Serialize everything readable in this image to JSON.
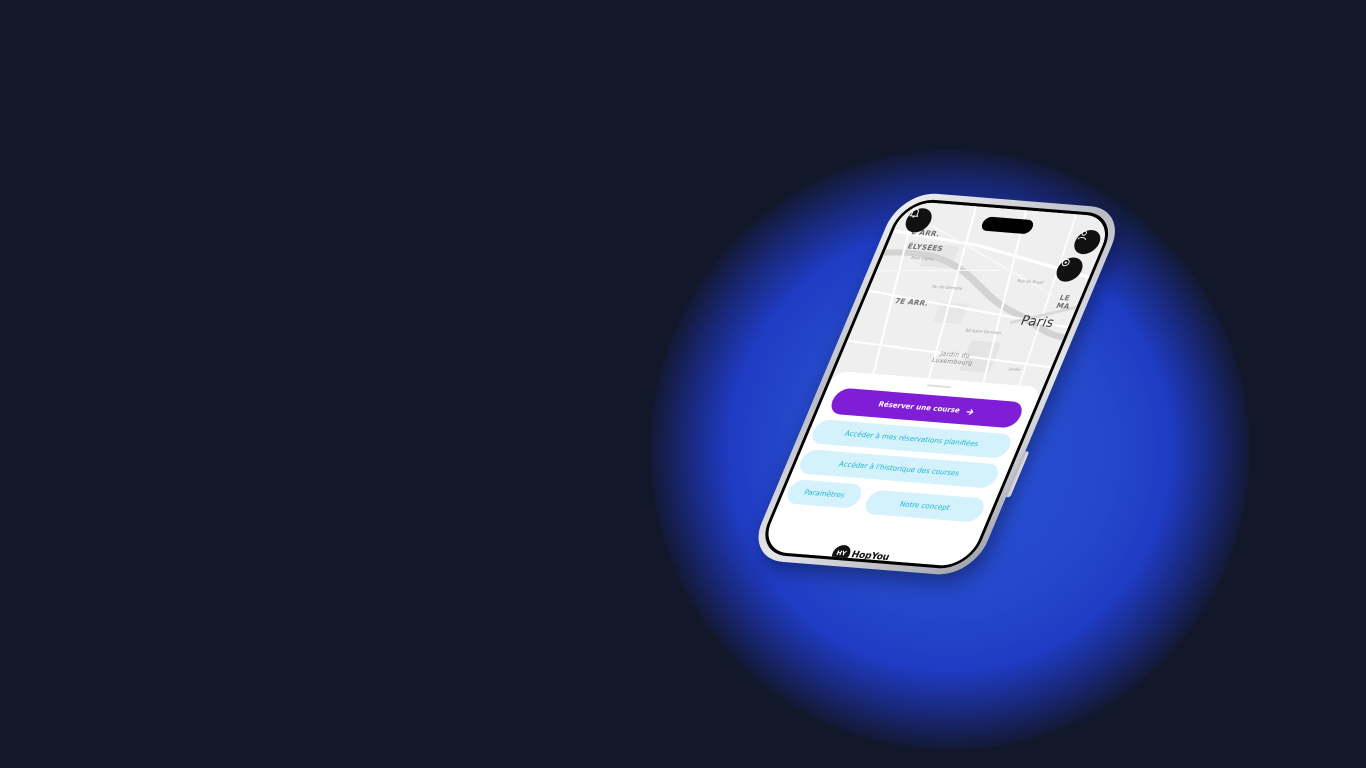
{
  "map": {
    "labels": {
      "arr8": "E ARR.",
      "elysees": "ÉLYSÉES",
      "arr7": "7E ARR.",
      "paris": "Paris",
      "luxembourg": "Jardin du Luxembourg",
      "lema": "LE MA",
      "street_1": "Pont d'Iéna",
      "street_2": "Av. de Grenelle",
      "street_3": "Rue de Rivoli",
      "street_4": "Bd Saint-Germain",
      "street_5": "Jardin"
    }
  },
  "sheet": {
    "primary_button": "Réserver une course",
    "reservations_button": "Accéder à mes réservations planifiées",
    "history_button": "Accéder à l'historique des courses",
    "settings_button": "Paramètres",
    "concept_button": "Notre concept"
  },
  "brand": {
    "logo_mark": "HY",
    "logo_text": "HopYou"
  },
  "icons": {
    "top_left": "bell-icon",
    "top_right": "user-icon",
    "locate": "locate-icon",
    "arrow": "arrow-right-icon"
  },
  "colors": {
    "background": "#121729",
    "glow": "#2547c9",
    "primary": "#7f1ed6",
    "secondary_bg": "#d4f2fb",
    "secondary_text": "#1cb6d8"
  }
}
